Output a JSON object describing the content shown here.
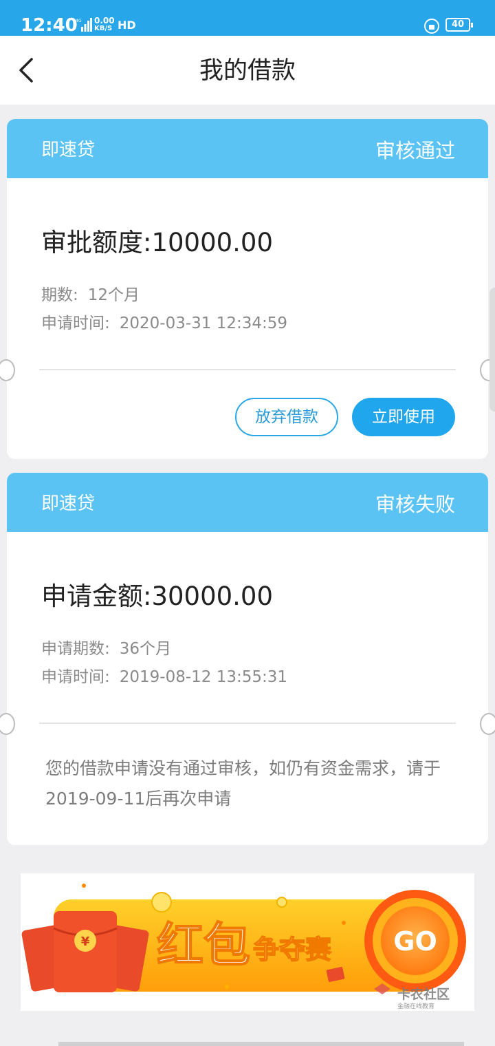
{
  "status_bar": {
    "time": "12:40",
    "network": "4G",
    "speed": "0.00",
    "speed_unit": "KB/S",
    "hd": "HD",
    "battery": "40"
  },
  "header": {
    "title": "我的借款"
  },
  "loans": [
    {
      "product": "即速贷",
      "status": "审核通过",
      "amount_label": "审批额度:",
      "amount": "10000.00",
      "term_label": "期数:",
      "term": "12个月",
      "time_label": "申请时间:",
      "time": "2020-03-31 12:34:59",
      "actions": {
        "abandon": "放弃借款",
        "use": "立即使用"
      }
    },
    {
      "product": "即速贷",
      "status": "审核失败",
      "amount_label": "申请金额:",
      "amount": "30000.00",
      "term_label": "申请期数:",
      "term": "36个月",
      "time_label": "申请时间:",
      "time": "2019-08-12 13:55:31",
      "notice": "您的借款申请没有通过审核，如仍有资金需求，请于2019-09-11后再次申请"
    }
  ],
  "banner": {
    "title_big": "红包",
    "title_small": "争夺赛",
    "go": "GO",
    "watermark": "卡农社区",
    "watermark_sub": "金融在线教育"
  },
  "colors": {
    "status_bar": "#27a6ea",
    "card_header": "#5bc3f3",
    "accent": "#1fa6ec"
  }
}
